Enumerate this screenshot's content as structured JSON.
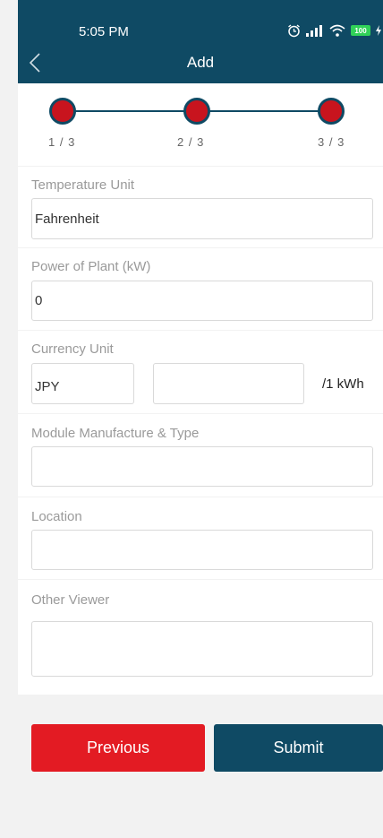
{
  "status": {
    "time": "5:05 PM",
    "battery": "100"
  },
  "header": {
    "title": "Add"
  },
  "stepper": {
    "steps": [
      "1 / 3",
      "2 / 3",
      "3 / 3"
    ]
  },
  "fields": {
    "temperature": {
      "label": "Temperature Unit",
      "value": "Fahrenheit"
    },
    "power": {
      "label": "Power of Plant (kW)",
      "value": "0"
    },
    "currency": {
      "label": "Currency Unit",
      "unit": "JPY",
      "price": "",
      "suffix": "/1 kWh"
    },
    "module": {
      "label": "Module Manufacture & Type",
      "value": ""
    },
    "location": {
      "label": "Location",
      "value": ""
    },
    "viewer": {
      "label": "Other Viewer",
      "value": ""
    }
  },
  "buttons": {
    "previous": "Previous",
    "submit": "Submit"
  },
  "colors": {
    "brand": "#0f4a64",
    "accent": "#c8141e",
    "previous_button": "#e31b23"
  }
}
